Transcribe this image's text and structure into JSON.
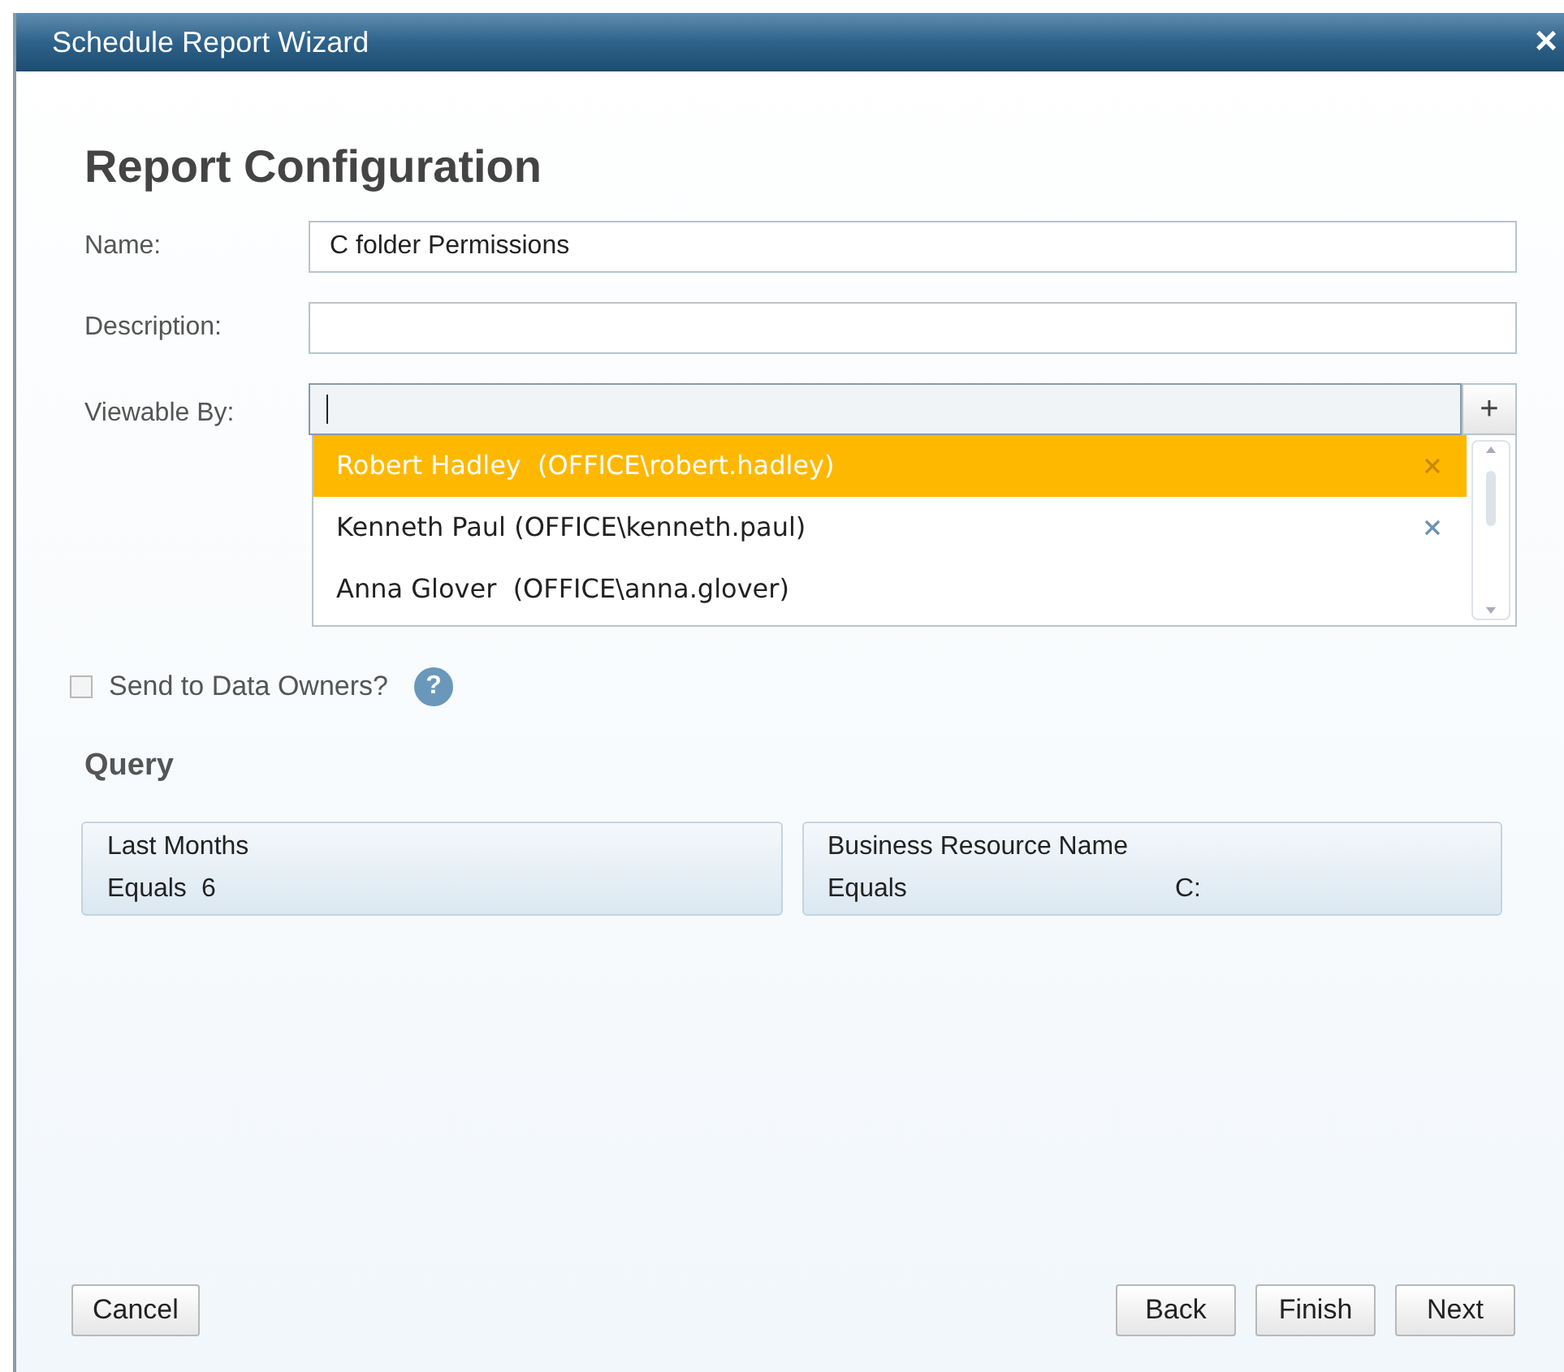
{
  "window": {
    "title": "Schedule Report Wizard",
    "close": "×"
  },
  "heading": "Report Configuration",
  "fields": [
    {
      "label": "Name:",
      "value": "C folder Permissions"
    },
    {
      "label": "Description:"
    }
  ],
  "viewable_by": {
    "label": "Viewable By:",
    "add": "+",
    "options": [
      {
        "text": "Robert Hadley  (OFFICE\\robert.hadley)",
        "selected": true,
        "removable": true
      },
      {
        "text": "Kenneth Paul (OFFICE\\kenneth.paul)",
        "selected": false,
        "removable": true
      },
      {
        "text": "Anna Glover  (OFFICE\\anna.glover)",
        "selected": false,
        "removable": false
      }
    ]
  },
  "send_to_owners": {
    "label": "Send to Data Owners?",
    "checked": false,
    "help": "?"
  },
  "query": {
    "title": "Query",
    "conditions": [
      {
        "field": "Last Months",
        "operator": "Equals",
        "value": "6"
      },
      {
        "field": "Business Resource Name",
        "operator": "Equals",
        "value": "C:"
      }
    ]
  },
  "buttons": {
    "left": [
      "Cancel"
    ],
    "right": [
      "Back",
      "Finish",
      "Next"
    ]
  }
}
